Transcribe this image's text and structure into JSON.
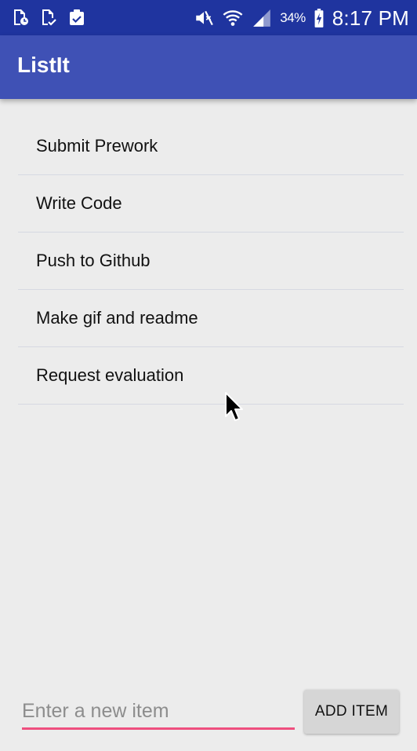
{
  "status_bar": {
    "left_icons": [
      "file-clock-icon",
      "file-check-icon",
      "clipboard-check-icon"
    ],
    "right_icons": [
      "mute-icon",
      "wifi-icon",
      "signal-icon",
      "battery-charging-icon"
    ],
    "battery_percent": "34%",
    "time": "8:17 PM"
  },
  "app_bar": {
    "title": "ListIt"
  },
  "items": [
    {
      "label": "Submit Prework"
    },
    {
      "label": "Write Code"
    },
    {
      "label": "Push to Github"
    },
    {
      "label": "Make gif and readme"
    },
    {
      "label": "Request evaluation"
    }
  ],
  "input": {
    "placeholder": "Enter a new item",
    "value": ""
  },
  "add_button": {
    "label": "ADD ITEM"
  },
  "colors": {
    "status_bar": "#1f349f",
    "app_bar": "#3f51b5",
    "accent": "#ef4f7f",
    "background": "#ececec",
    "button": "#d6d6d6"
  }
}
